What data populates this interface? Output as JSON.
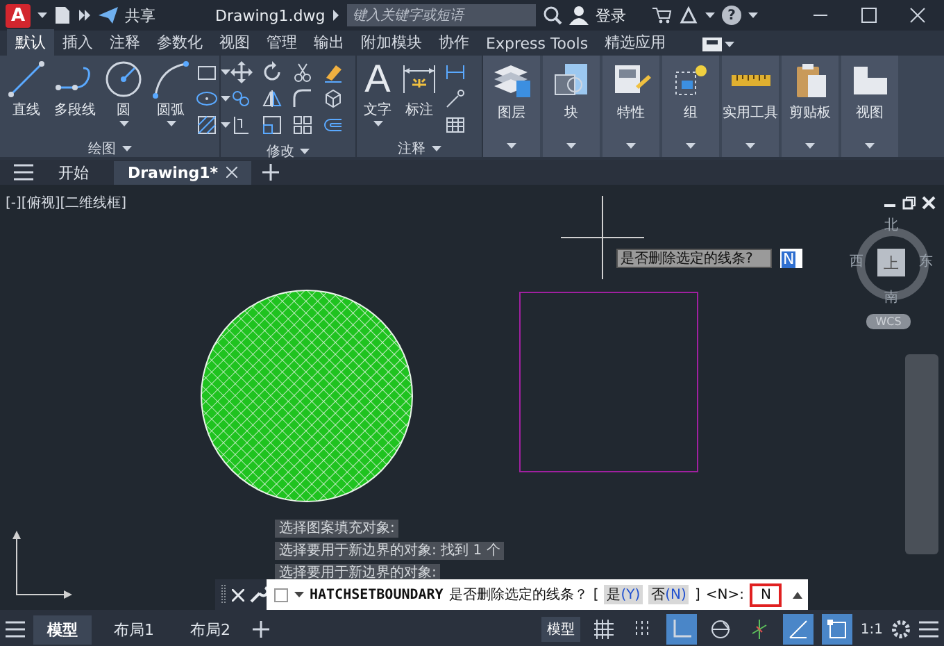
{
  "title_bar": {
    "logo": "A",
    "share": "共享",
    "title": "Drawing1.dwg",
    "search": {
      "placeholder": "键入关键字或短语"
    },
    "login": "登录",
    "help": "?"
  },
  "ribbon_tabs": [
    {
      "label": "默认",
      "selected": true
    },
    {
      "label": "插入",
      "selected": false
    },
    {
      "label": "注释",
      "selected": false
    },
    {
      "label": "参数化",
      "selected": false
    },
    {
      "label": "视图",
      "selected": false
    },
    {
      "label": "管理",
      "selected": false
    },
    {
      "label": "输出",
      "selected": false
    },
    {
      "label": "附加模块",
      "selected": false
    },
    {
      "label": "协作",
      "selected": false
    },
    {
      "label": "Express Tools",
      "selected": false
    },
    {
      "label": "精选应用",
      "selected": false
    }
  ],
  "ribbon_panels": [
    {
      "title": "绘图",
      "kind": "draw",
      "tools": [
        {
          "label": "直线",
          "kind": "line"
        },
        {
          "label": "多段线",
          "kind": "polyline"
        },
        {
          "label": "圆",
          "kind": "circle"
        },
        {
          "label": "圆弧",
          "kind": "arc"
        }
      ]
    },
    {
      "title": "修改",
      "kind": "modify"
    },
    {
      "title": "注释",
      "kind": "annotate",
      "tools": [
        {
          "label": "文字",
          "kind": "text",
          "glyph": "A"
        },
        {
          "label": "标注",
          "kind": "dimension"
        }
      ]
    }
  ],
  "ribbon_buttons": [
    {
      "label": "图层",
      "kind": "layers"
    },
    {
      "label": "块",
      "kind": "block"
    },
    {
      "label": "特性",
      "kind": "properties"
    },
    {
      "label": "组",
      "kind": "group"
    },
    {
      "label": "实用工具",
      "kind": "ruler"
    },
    {
      "label": "剪贴板",
      "kind": "clipboard"
    },
    {
      "label": "视图",
      "kind": "view"
    }
  ],
  "file_tabs": [
    {
      "label": "开始",
      "selected": false
    },
    {
      "label": "Drawing1*",
      "selected": true
    }
  ],
  "viewport": {
    "label": "[-][俯视][二维线框]",
    "prompt": "是否删除选定的线条?",
    "prompt_value": "N",
    "viewcube": {
      "top": "上",
      "north": "北",
      "south": "南",
      "west": "西",
      "east": "东",
      "ucs": "WCS"
    }
  },
  "command_history": [
    "选择图案填充对象:",
    "选择要用于新边界的对象: 找到 1 个",
    "选择要用于新边界的对象:"
  ],
  "command_line": {
    "command": "HATCHSETBOUNDARY",
    "prompt": "是否删除选定的线条？",
    "bracket_open": "[",
    "options": [
      {
        "label": "是",
        "key": "(Y)"
      },
      {
        "label": "否",
        "key": "(N)"
      }
    ],
    "bracket_close": "]",
    "default": "<N>:",
    "value": "N"
  },
  "layout_tabs": [
    {
      "label": "模型",
      "selected": true
    },
    {
      "label": "布局1",
      "selected": false
    },
    {
      "label": "布局2",
      "selected": false
    }
  ],
  "status_bar": {
    "model": "模型",
    "scale": "1:1",
    "toggles": [
      {
        "kind": "grid",
        "on": false
      },
      {
        "kind": "snap",
        "on": false
      },
      {
        "kind": "ortho",
        "on": true
      },
      {
        "kind": "polar",
        "on": false
      },
      {
        "kind": "osnap",
        "on": false
      },
      {
        "kind": "iso",
        "on": true
      },
      {
        "kind": "ucs",
        "on": true
      }
    ]
  }
}
